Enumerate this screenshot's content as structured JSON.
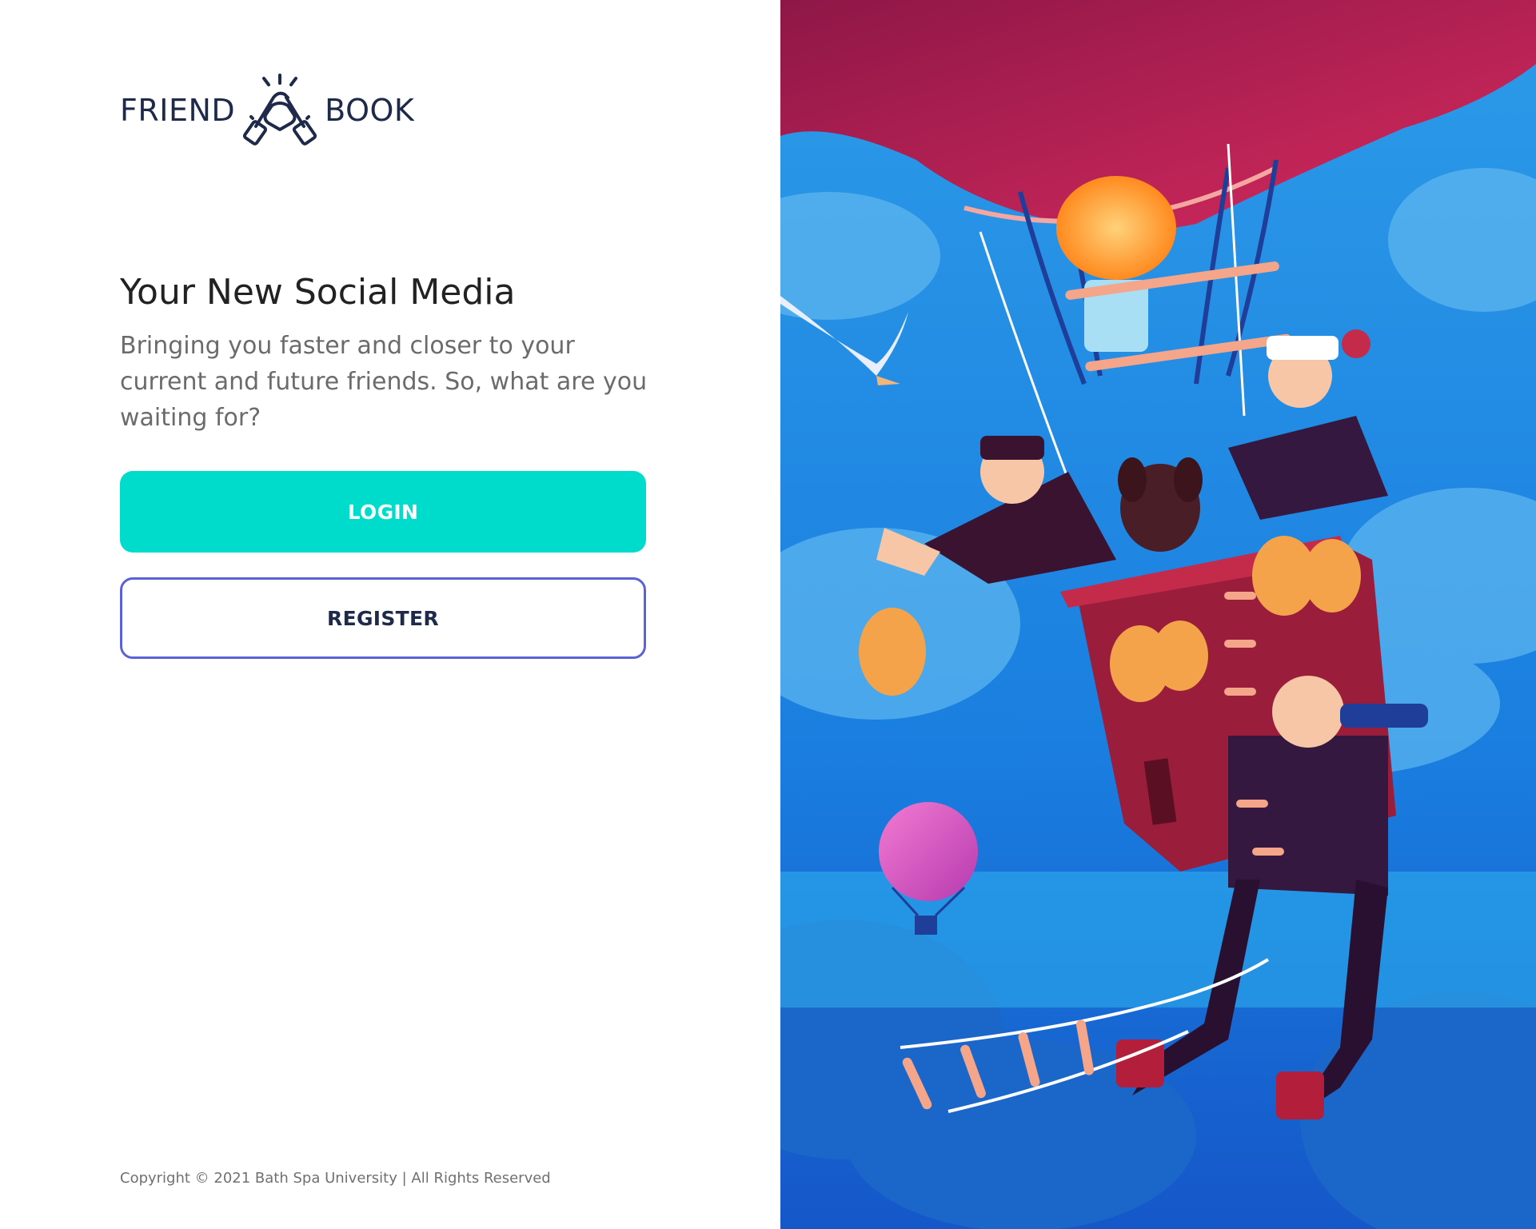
{
  "brand": {
    "word_left": "FRIEND",
    "word_right": "BOOK",
    "logo_icon": "handshake-icon"
  },
  "hero": {
    "title": "Your New Social Media",
    "subtitle": "Bringing you faster and closer to your current and future friends. So, what are you waiting for?"
  },
  "actions": {
    "login_label": "LOGIN",
    "register_label": "REGISTER"
  },
  "footer": {
    "copyright": "Copyright © 2021 Bath Spa University | All Rights Reserved"
  },
  "colors": {
    "primary": "#00dccb",
    "register_border": "#5b62d6",
    "brand_text": "#1f2a4a",
    "sky": "#1e88e5",
    "balloon": "#b5204f"
  },
  "illustration": {
    "subject": "hot-air-balloon-adventurers-illustration"
  }
}
